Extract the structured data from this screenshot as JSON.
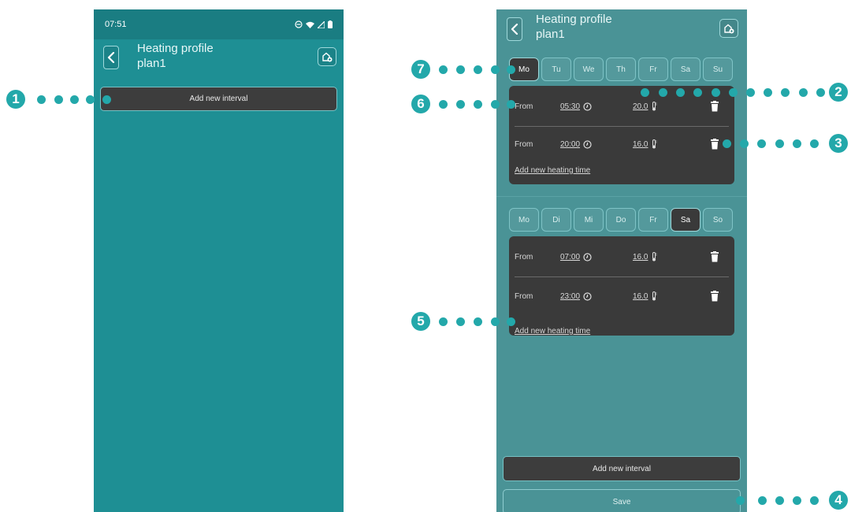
{
  "left_screen": {
    "status_time": "07:51",
    "header": {
      "title": "Heating profile",
      "subtitle": "plan1"
    },
    "add_interval_label": "Add new interval"
  },
  "right_screen": {
    "header": {
      "title": "Heating profile",
      "subtitle": "plan1"
    },
    "interval1": {
      "days": [
        "Mo",
        "Tu",
        "We",
        "Th",
        "Fr",
        "Sa",
        "Su"
      ],
      "selected_day": "Mo",
      "rows": [
        {
          "from_label": "From",
          "time": "05:30",
          "temp": "20.0"
        },
        {
          "from_label": "From",
          "time": "20:00",
          "temp": "16.0"
        }
      ],
      "add_heating_time_label": "Add new heating time"
    },
    "interval2": {
      "days": [
        "Mo",
        "Di",
        "Mi",
        "Do",
        "Fr",
        "Sa",
        "So"
      ],
      "selected_day": "Sa",
      "rows": [
        {
          "from_label": "From",
          "time": "07:00",
          "temp": "16.0"
        },
        {
          "from_label": "From",
          "time": "23:00",
          "temp": "16.0"
        }
      ],
      "add_heating_time_label": "Add new heating time"
    },
    "add_interval_label": "Add new interval",
    "save_label": "Save"
  },
  "callouts": [
    "1",
    "2",
    "3",
    "4",
    "5",
    "6",
    "7"
  ],
  "colors": {
    "teal_bg": "#1e8f94",
    "teal_muted": "#4a9396",
    "dark_card": "#3a3a3a",
    "callout": "#23a8aa"
  }
}
